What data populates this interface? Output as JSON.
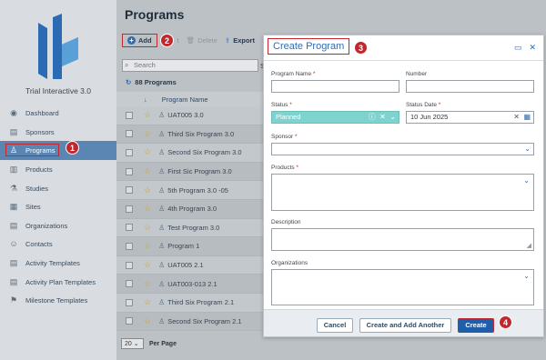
{
  "app_name": "Trial Interactive 3.0",
  "sidebar": {
    "items": [
      {
        "label": "Dashboard",
        "icon": "dashboard-icon",
        "glyph": "◉"
      },
      {
        "label": "Sponsors",
        "icon": "sponsors-icon",
        "glyph": "▤"
      },
      {
        "label": "Programs",
        "icon": "programs-icon",
        "glyph": "♙",
        "active": true
      },
      {
        "label": "Products",
        "icon": "products-icon",
        "glyph": "▥"
      },
      {
        "label": "Studies",
        "icon": "studies-icon",
        "glyph": "⚗"
      },
      {
        "label": "Sites",
        "icon": "sites-icon",
        "glyph": "▦"
      },
      {
        "label": "Organizations",
        "icon": "organizations-icon",
        "glyph": "▤"
      },
      {
        "label": "Contacts",
        "icon": "contacts-icon",
        "glyph": "☺"
      },
      {
        "label": "Activity Templates",
        "icon": "activity-templates-icon",
        "glyph": "▤"
      },
      {
        "label": "Activity Plan Templates",
        "icon": "activity-plan-templates-icon",
        "glyph": "▤"
      },
      {
        "label": "Milestone Templates",
        "icon": "milestone-templates-icon",
        "glyph": "⚑"
      }
    ]
  },
  "main": {
    "title": "Programs",
    "toolbar": {
      "add": "Add",
      "edit_trunc": "t",
      "delete": "Delete",
      "export": "Export"
    },
    "search_placeholder": "Search",
    "search_trunc": "Se",
    "count": "88 Programs",
    "column_header": "Program Name",
    "rows": [
      "UAT005 3.0",
      "Third Six Program 3.0",
      "Second Six Program 3.0",
      "First Sic Program 3.0",
      "5th Program 3.0 -05",
      "4th Program 3.0",
      "Test Program 3.0",
      "Program 1",
      "UAT005 2.1",
      "UAT003-013 2.1",
      "Third Six Program 2.1",
      "Second Six Program 2.1"
    ],
    "page_size": "20",
    "per_page_label": "Per Page"
  },
  "dialog": {
    "title": "Create Program",
    "fields": {
      "program_name_label": "Program Name",
      "program_name_value": "",
      "number_label": "Number",
      "number_value": "",
      "status_label": "Status",
      "status_value": "Planned",
      "status_date_label": "Status Date",
      "status_date_value": "10 Jun 2025",
      "sponsor_label": "Sponsor",
      "products_label": "Products",
      "description_label": "Description",
      "organizations_label": "Organizations"
    },
    "buttons": {
      "cancel": "Cancel",
      "create_add_another": "Create and Add Another",
      "create": "Create"
    }
  },
  "markers": [
    "1",
    "2",
    "3",
    "4"
  ],
  "colors": {
    "accent": "#2f6db3",
    "highlight_border": "#c0282d",
    "status_teal": "#7fd3cf",
    "sidebar_active": "#5b86b3"
  }
}
